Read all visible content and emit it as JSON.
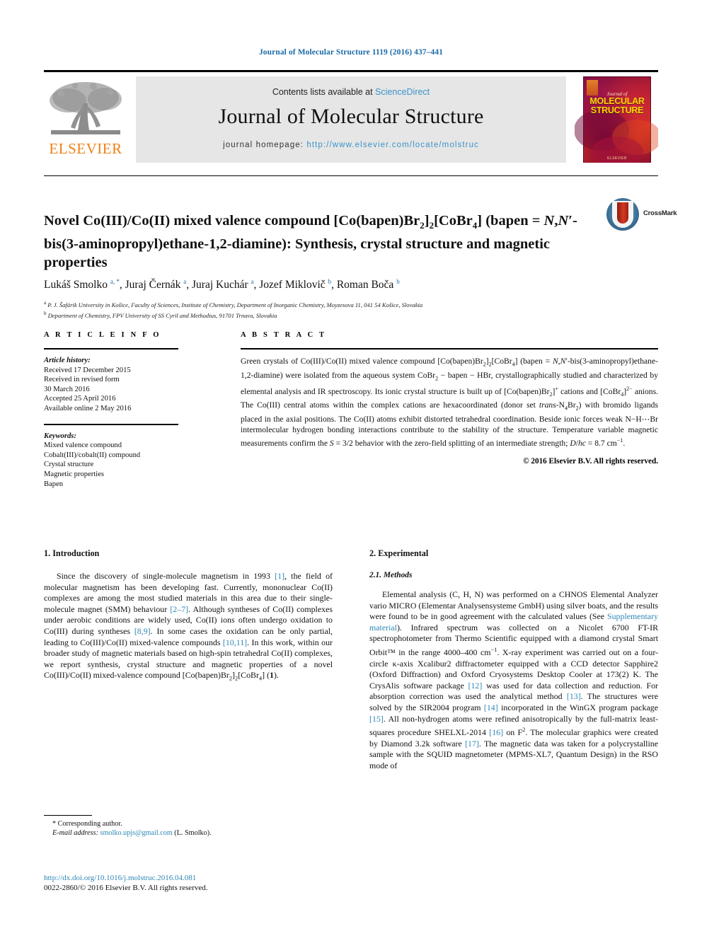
{
  "running_head": "Journal of Molecular Structure 1119 (2016) 437–441",
  "masthead": {
    "contents_prefix": "Contents lists available at ",
    "sciencedirect": "ScienceDirect",
    "journal_title": "Journal of Molecular Structure",
    "homepage_label": "journal homepage: ",
    "homepage_url": "http://www.elsevier.com/locate/molstruc",
    "elsevier_wordmark": "ELSEVIER",
    "cover": {
      "journal_of": "Journal of",
      "title_line1": "MOLECULAR",
      "title_line2": "STRUCTURE",
      "footer": "ELSEVIER"
    }
  },
  "crossmark": {
    "label": "CrossMark"
  },
  "article": {
    "title_html": "Novel Co(III)/Co(II) mixed valence compound [Co(bapen)Br<sub>2</sub>]<sub>2</sub>[CoBr<sub>4</sub>] (bapen = <i>N</i>,<i>N</i>′-bis(3-aminopropyl)ethane-1,2-diamine): Synthesis, crystal structure and magnetic properties",
    "authors_html": "Lukáš Smolko <sup>a, *</sup>, Juraj Černák <sup>a</sup>, Juraj Kuchár <sup>a</sup>, Jozef Miklovič <sup>b</sup>, Roman Boča <sup>b</sup>",
    "affiliation_a": "P. J. Šafárik University in Košice, Faculty of Sciences, Institute of Chemistry, Department of Inorganic Chemistry, Moyzesova 11, 041 54 Košice, Slovakia",
    "affiliation_b": "Department of Chemistry, FPV University of SS Cyril and Methodius, 91701 Trnava, Slovakia"
  },
  "article_info": {
    "heading": "A R T I C L E  I N F O",
    "history_label": "Article history:",
    "history": [
      "Received 17 December 2015",
      "Received in revised form",
      "30 March 2016",
      "Accepted 25 April 2016",
      "Available online 2 May 2016"
    ],
    "keywords_label": "Keywords:",
    "keywords": [
      "Mixed valence compound",
      "Cobalt(III)/cobalt(II) compound",
      "Crystal structure",
      "Magnetic properties",
      "Bapen"
    ]
  },
  "abstract": {
    "heading": "A B S T R A C T",
    "text_html": "Green crystals of Co(III)/Co(II) mixed valence compound [Co(bapen)Br<sub>2</sub>]<sub>2</sub>[CoBr<sub>4</sub>] (bapen = <i>N</i>,<i>N</i>′-bis(3-aminopropyl)ethane-1,2-diamine) were isolated from the aqueous system CoBr<sub>2</sub> − bapen − HBr, crystallographically studied and characterized by elemental analysis and IR spectroscopy. Its ionic crystal structure is built up of [Co(bapen)Br<sub>2</sub>]<sup>+</sup> cations and [CoBr<sub>4</sub>]<sup>2−</sup> anions. The Co(III) central atoms within the complex cations are hexacoordinated (donor set <i>trans</i>-N<sub>4</sub>Br<sub>2</sub>) with bromido ligands placed in the axial positions. The Co(II) atoms exhibit distorted tetrahedral coordination. Beside ionic forces weak N−H⋯Br intermolecular hydrogen bonding interactions contribute to the stability of the structure. Temperature variable magnetic measurements confirm the <i>S</i> = 3/2 behavior with the zero-field splitting of an intermediate strength; <i>D</i>/<i>hc</i> = 8.7 cm<sup>−1</sup>.",
    "copyright": "© 2016 Elsevier B.V. All rights reserved."
  },
  "sections": {
    "introduction": {
      "heading": "1.  Introduction",
      "paragraph_html": "Since the discovery of single-molecule magnetism in 1993 <span class=\"ref\">[1]</span>, the field of molecular magnetism has been developing fast. Currently, mononuclear Co(II) complexes are among the most studied materials in this area due to their single-molecule magnet (SMM) behaviour <span class=\"ref\">[2–7]</span>. Although syntheses of Co(II) complexes under aerobic conditions are widely used, Co(II) ions often undergo oxidation to Co(III) during syntheses <span class=\"ref\">[8,9]</span>. In some cases the oxidation can be only partial, leading to Co(III)/Co(II) mixed-valence compounds <span class=\"ref\">[10,11]</span>. In this work, within our broader study of magnetic materials based on high-spin tetrahedral Co(II) complexes, we report synthesis, crystal structure and magnetic properties of a novel Co(III)/Co(II) mixed-valence compound [Co(bapen)Br<sub>2</sub>]<sub>2</sub>[CoBr<sub>4</sub>] (<b>1</b>)."
    },
    "experimental": {
      "heading": "2.  Experimental",
      "subheading": "2.1.  Methods",
      "paragraph_html": "Elemental analysis (C, H, N) was performed on a CHNOS Elemental Analyzer vario MICRO (Elementar Analysensysteme GmbH) using silver boats, and the results were found to be in good agreement with the calculated values (See <span class=\"ref\">Supplementary material</span>). Infrared spectrum was collected on a Nicolet 6700 FT-IR spectrophotometer from Thermo Scientific equipped with a diamond crystal Smart Orbit™ in the range 4000–400 cm<sup>−1</sup>. X-ray experiment was carried out on a four-circle κ-axis Xcalibur2 diffractometer equipped with a CCD detector Sapphire2 (Oxford Diffraction) and Oxford Cryosystems Desktop Cooler at 173(2) K. The CrysAlis software package <span class=\"ref\">[12]</span> was used for data collection and reduction. For absorption correction was used the analytical method <span class=\"ref\">[13]</span>. The structures were solved by the SIR2004 program <span class=\"ref\">[14]</span> incorporated in the WinGX program package <span class=\"ref\">[15]</span>. All non-hydrogen atoms were refined anisotropically by the full-matrix least-squares procedure SHELXL-2014 <span class=\"ref\">[16]</span> on F<sup>2</sup>. The molecular graphics were created by Diamond 3.2k software <span class=\"ref\">[17]</span>. The magnetic data was taken for a polycrystalline sample with the SQUID magnetometer (MPMS-XL7, Quantum Design) in the RSO mode of"
    }
  },
  "footnote": {
    "corresponding": "* Corresponding author.",
    "email_label": "E-mail address:",
    "email": "smolko.upjs@gmail.com",
    "email_suffix": "(L. Smolko)."
  },
  "bottom": {
    "doi": "http://dx.doi.org/10.1016/j.molstruc.2016.04.081",
    "issn": "0022-2860/© 2016 Elsevier B.V. All rights reserved."
  },
  "colors": {
    "link": "#2e86b5",
    "running_head": "#1a6ba8",
    "elsevier_orange": "#f07f13",
    "banner_bg": "#e6e6e6"
  }
}
